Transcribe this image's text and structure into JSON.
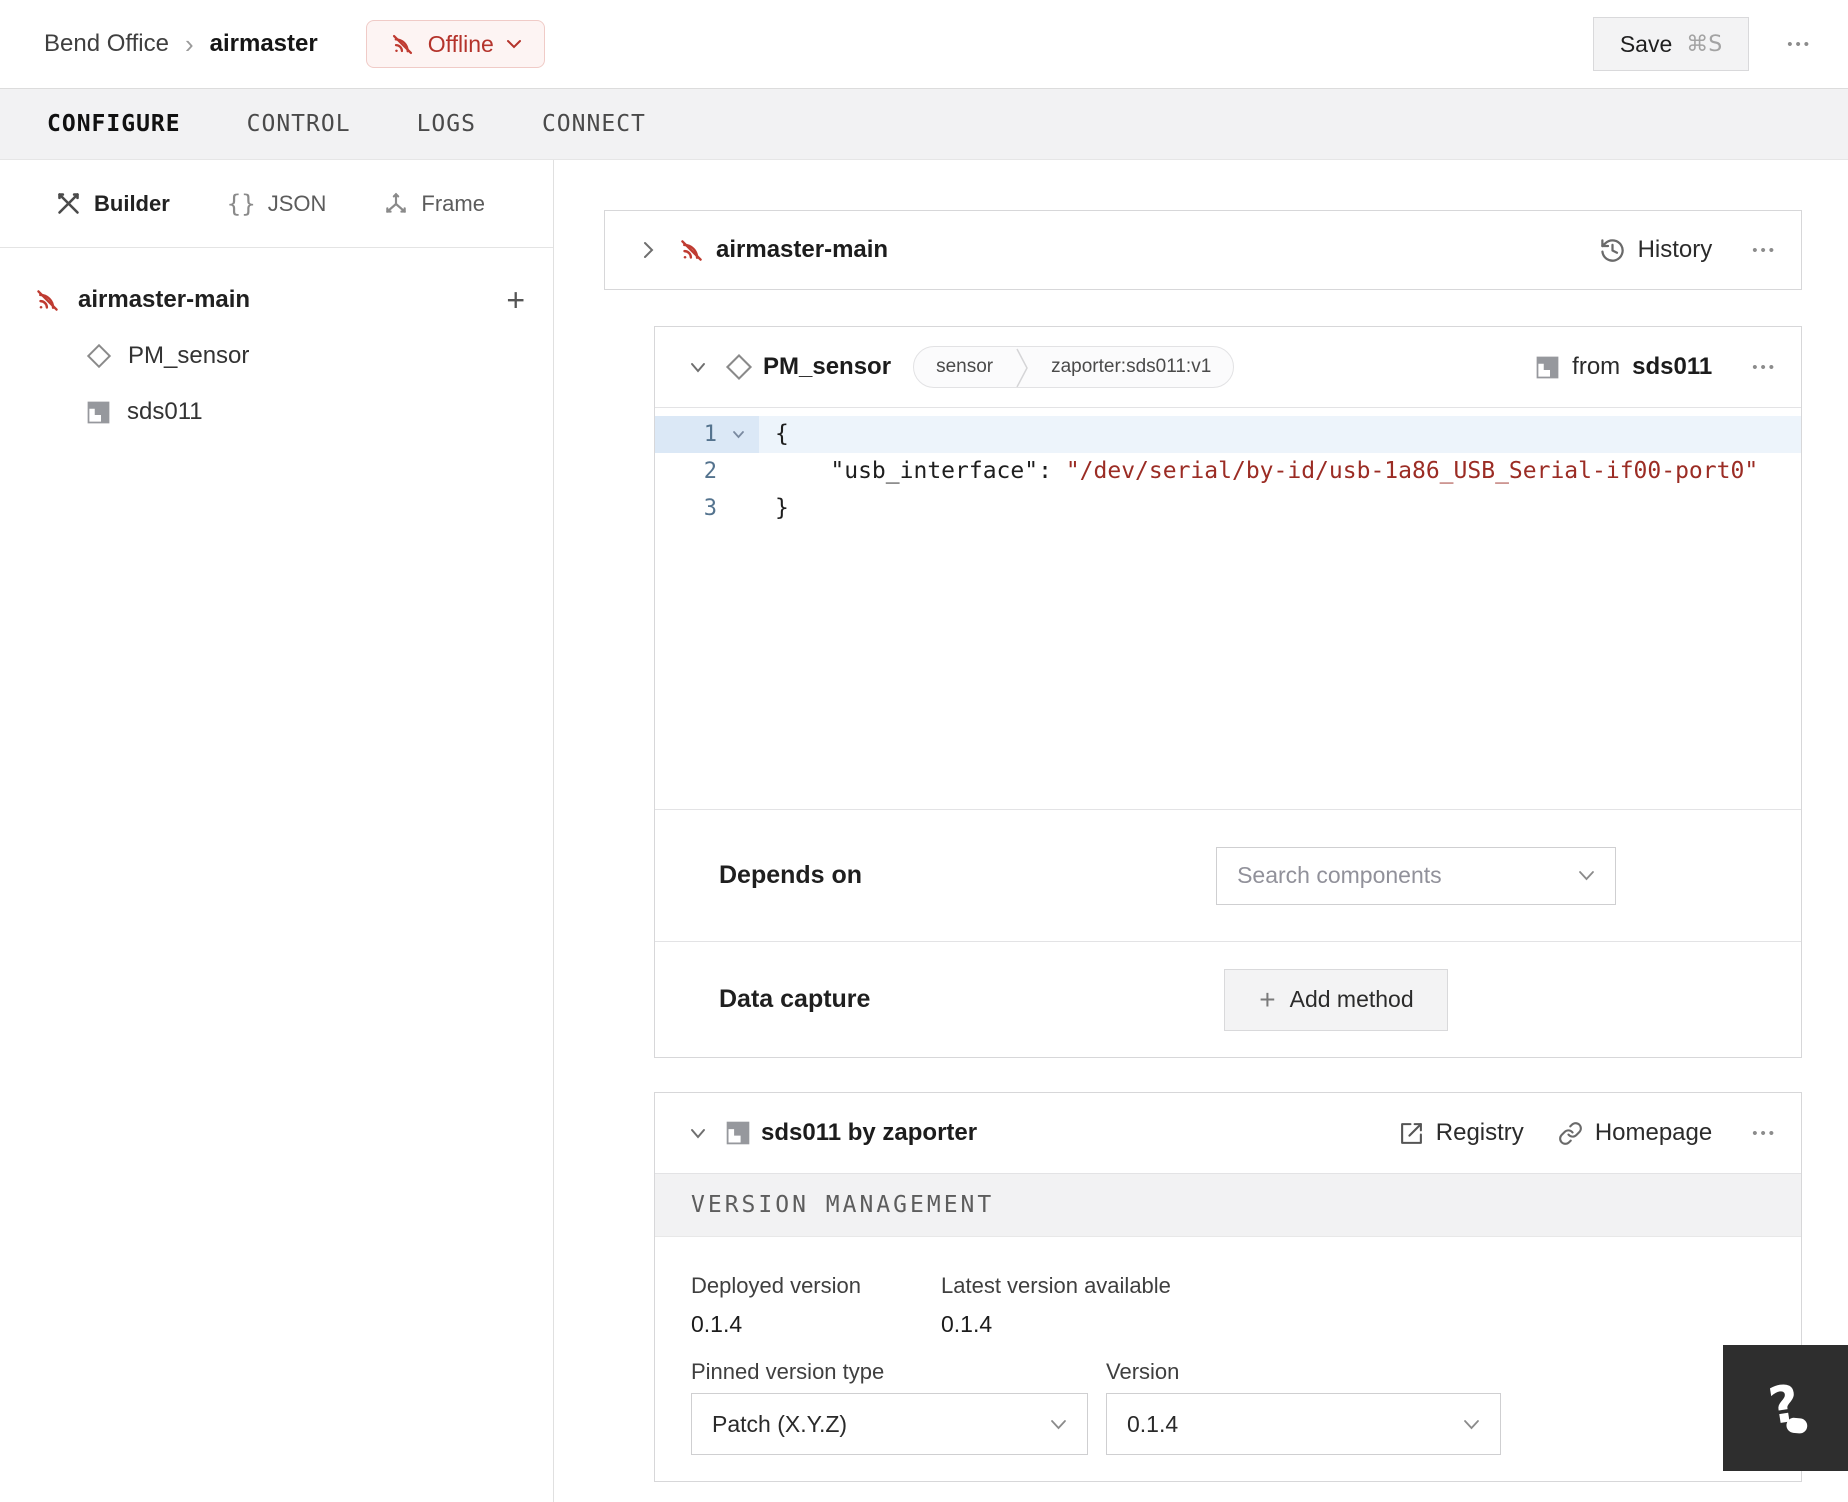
{
  "header": {
    "breadcrumb": {
      "org": "Bend Office",
      "machine": "airmaster"
    },
    "status_badge": {
      "label": "Offline"
    },
    "save": {
      "label": "Save",
      "shortcut": "⌘S"
    }
  },
  "nav_tabs": [
    {
      "label": "CONFIGURE",
      "active": true
    },
    {
      "label": "CONTROL",
      "active": false
    },
    {
      "label": "LOGS",
      "active": false
    },
    {
      "label": "CONNECT",
      "active": false
    }
  ],
  "sidebar": {
    "views": [
      {
        "label": "Builder",
        "icon": "builder-tools-icon",
        "active": true
      },
      {
        "label": "JSON",
        "icon": "braces-icon",
        "active": false
      },
      {
        "label": "Frame",
        "icon": "axes-icon",
        "active": false
      }
    ],
    "tree": {
      "root": {
        "label": "airmaster-main",
        "icon": "offline-icon"
      },
      "children": [
        {
          "label": "PM_sensor",
          "icon": "diamond-icon"
        },
        {
          "label": "sds011",
          "icon": "module-icon"
        }
      ]
    }
  },
  "machine_card": {
    "title": "airmaster-main",
    "history_label": "History"
  },
  "component_card": {
    "title": "PM_sensor",
    "type_badge": "sensor",
    "model_badge": "zaporter:sds011:v1",
    "from_label": "from",
    "from_module": "sds011",
    "editor": {
      "lines": [
        {
          "num": "1",
          "code": "{"
        },
        {
          "num": "2",
          "key": "    \"usb_interface\"",
          "sep": ": ",
          "value": "\"/dev/serial/by-id/usb-1a86_USB_Serial-if00-port0\""
        },
        {
          "num": "3",
          "code": "}"
        }
      ]
    },
    "depends_on": {
      "label": "Depends on",
      "placeholder": "Search components"
    },
    "data_capture": {
      "label": "Data capture",
      "add_button": "Add method"
    }
  },
  "module_card": {
    "title": "sds011 by zaporter",
    "registry_label": "Registry",
    "homepage_label": "Homepage",
    "section_title": "VERSION MANAGEMENT",
    "deployed": {
      "label": "Deployed version",
      "value": "0.1.4"
    },
    "latest": {
      "label": "Latest version available",
      "value": "0.1.4"
    },
    "pinned_type": {
      "label": "Pinned version type",
      "value": "Patch (X.Y.Z)"
    },
    "version": {
      "label": "Version",
      "value": "0.1.4"
    }
  },
  "icons": {
    "ellipsis": "•••",
    "plus": "+",
    "breadcrumb_separator": "›",
    "braces": "{}"
  },
  "colors": {
    "accent_red": "#b4332b",
    "badge_bg": "#fdf4f3",
    "code_string": "#9b2c24",
    "line_highlight": "#edf4fb",
    "tabbar_bg": "#f2f2f3"
  }
}
